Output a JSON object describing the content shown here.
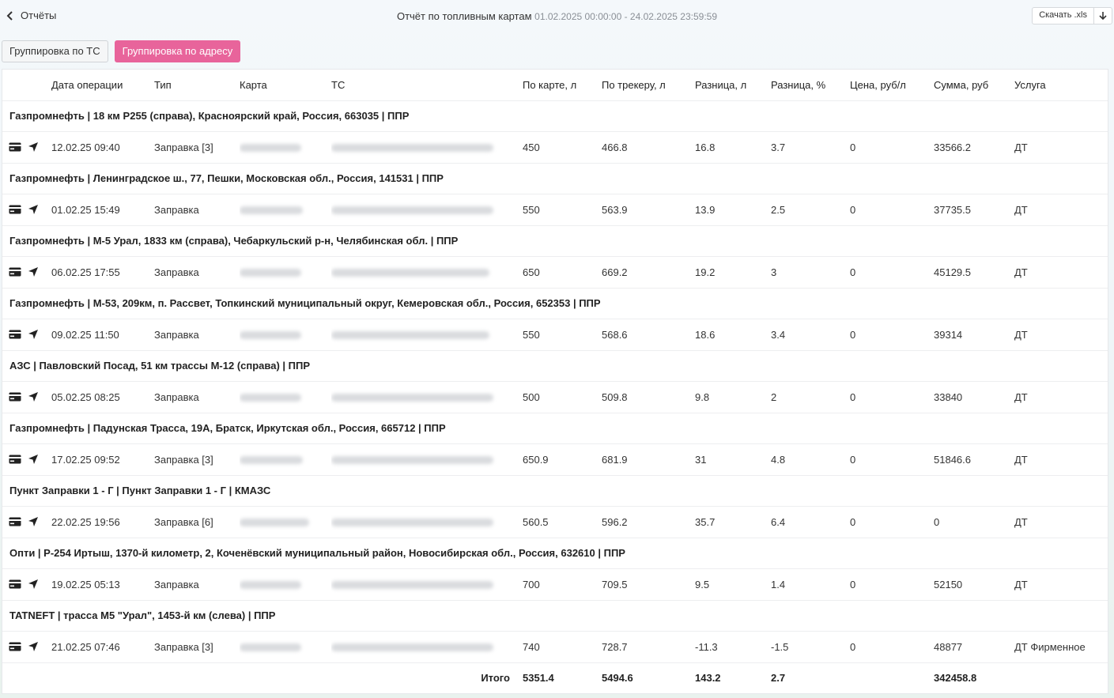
{
  "header": {
    "back_label": "Отчёты",
    "title": "Отчёт по топливным картам",
    "period": "01.02.2025 00:00:00 - 24.02.2025 23:59:59",
    "download_label": "Скачать .xls"
  },
  "tabs": [
    {
      "label": "Группировка по ТС",
      "active": false
    },
    {
      "label": "Группировка по адресу",
      "active": true
    }
  ],
  "columns": [
    "Дата операции",
    "Тип",
    "Карта",
    "ТС",
    "По карте, л",
    "По трекеру, л",
    "Разница, л",
    "Разница, %",
    "Цена, руб/л",
    "Сумма, руб",
    "Услуга"
  ],
  "colors": {
    "accent": "#e8649b",
    "green": "#2f9e44",
    "yellow": "#e0a624",
    "red": "#d9363e"
  },
  "groups": [
    {
      "title": "Газпромнефть | 18 км Р255 (справа), Красноярский край, Россия, 663035 | ППР",
      "op": {
        "date": "12.02.25 09:40",
        "type": "Заправка [3]",
        "card_len": 78,
        "vehicle_len": 205,
        "by_card": "450",
        "by_tracker": "466.8",
        "diff_l": "16.8",
        "diff_pct": "3.7",
        "status": "y",
        "price": "0",
        "sum": "33566.2",
        "service": "ДТ"
      }
    },
    {
      "title": "Газпромнефть | Ленинградское ш., 77, Пешки, Московская обл., Россия, 141531 | ППР",
      "op": {
        "date": "01.02.25 15:49",
        "type": "Заправка",
        "card_len": 80,
        "vehicle_len": 205,
        "by_card": "550",
        "by_tracker": "563.9",
        "diff_l": "13.9",
        "diff_pct": "2.5",
        "status": "g",
        "price": "0",
        "sum": "37735.5",
        "service": "ДТ"
      }
    },
    {
      "title": "Газпромнефть | М-5 Урал, 1833 км (справа), Чебаркульский р-н, Челябинская обл. | ППР",
      "op": {
        "date": "06.02.25 17:55",
        "type": "Заправка",
        "card_len": 78,
        "vehicle_len": 200,
        "by_card": "650",
        "by_tracker": "669.2",
        "diff_l": "19.2",
        "diff_pct": "3",
        "status": "g",
        "price": "0",
        "sum": "45129.5",
        "service": "ДТ"
      }
    },
    {
      "title": "Газпромнефть | М-53, 209км, п. Рассвет, Топкинский муниципальный округ, Кемеровская обл., Россия, 652353 | ППР",
      "op": {
        "date": "09.02.25 11:50",
        "type": "Заправка",
        "card_len": 78,
        "vehicle_len": 200,
        "by_card": "550",
        "by_tracker": "568.6",
        "diff_l": "18.6",
        "diff_pct": "3.4",
        "status": "y",
        "price": "0",
        "sum": "39314",
        "service": "ДТ"
      }
    },
    {
      "title": "АЗС | Павловский Посад, 51 км трассы М-12 (справа) | ППР",
      "op": {
        "date": "05.02.25 08:25",
        "type": "Заправка",
        "card_len": 78,
        "vehicle_len": 205,
        "by_card": "500",
        "by_tracker": "509.8",
        "diff_l": "9.8",
        "diff_pct": "2",
        "status": "g",
        "price": "0",
        "sum": "33840",
        "service": "ДТ"
      }
    },
    {
      "title": "Газпромнефть | Падунская Трасса, 19А, Братск, Иркутская обл., Россия, 665712 | ППР",
      "op": {
        "date": "17.02.25 09:52",
        "type": "Заправка [3]",
        "card_len": 80,
        "vehicle_len": 205,
        "by_card": "650.9",
        "by_tracker": "681.9",
        "diff_l": "31",
        "diff_pct": "4.8",
        "status": "y",
        "price": "0",
        "sum": "51846.6",
        "service": "ДТ"
      }
    },
    {
      "title": "Пункт Заправки 1 - Г | Пункт Заправки 1 - Г | КМАЗС",
      "op": {
        "date": "22.02.25 19:56",
        "type": "Заправка [6]",
        "card_len": 88,
        "vehicle_len": 205,
        "by_card": "560.5",
        "by_tracker": "596.2",
        "diff_l": "35.7",
        "diff_pct": "6.4",
        "status": "r",
        "price": "0",
        "sum": "0",
        "service": "ДТ"
      }
    },
    {
      "title": "Опти | Р-254 Иртыш, 1370-й километр, 2, Коченёвский муниципальный район, Новосибирская обл., Россия, 632610 | ППР",
      "op": {
        "date": "19.02.25 05:13",
        "type": "Заправка",
        "card_len": 78,
        "vehicle_len": 205,
        "by_card": "700",
        "by_tracker": "709.5",
        "diff_l": "9.5",
        "diff_pct": "1.4",
        "status": "g",
        "price": "0",
        "sum": "52150",
        "service": "ДТ"
      }
    },
    {
      "title": "TATNEFT | трасса М5 \"Урал\", 1453-й км (слева) | ППР",
      "op": {
        "date": "21.02.25 07:46",
        "type": "Заправка [3]",
        "card_len": 78,
        "vehicle_len": 205,
        "by_card": "740",
        "by_tracker": "728.7",
        "diff_l": "-11.3",
        "diff_pct": "-1.5",
        "status": "g",
        "price": "0",
        "sum": "48877",
        "service": "ДТ Фирменное"
      }
    }
  ],
  "totals": {
    "label": "Итого",
    "by_card": "5351.4",
    "by_tracker": "5494.6",
    "diff_l": "143.2",
    "diff_pct": "2.7",
    "sum": "342458.8",
    "status": "g"
  }
}
